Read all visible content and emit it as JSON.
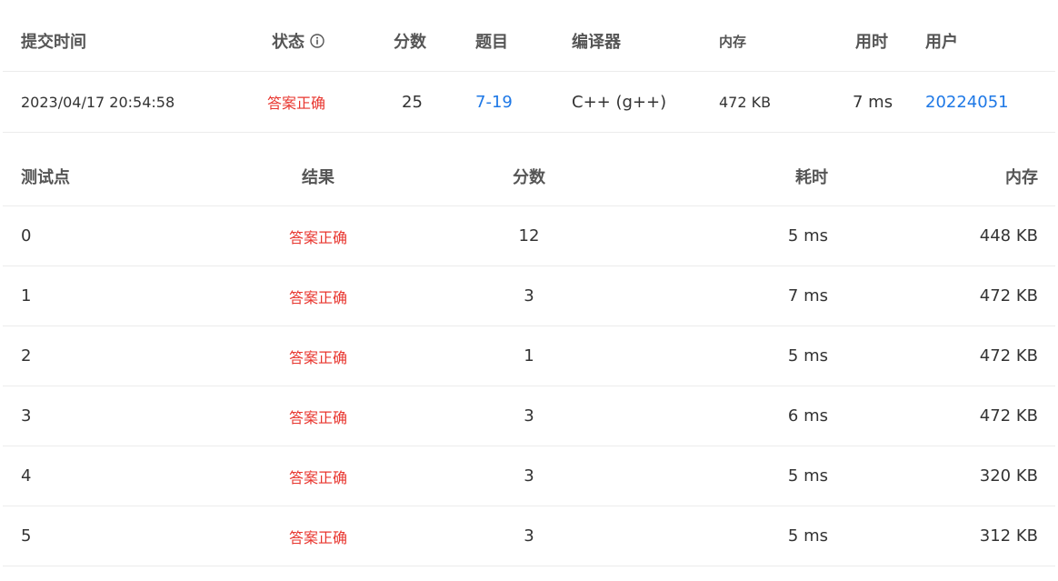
{
  "submission": {
    "headers": {
      "time": "提交时间",
      "status": "状态",
      "score": "分数",
      "problem": "题目",
      "compiler": "编译器",
      "memory": "内存",
      "elapsed": "用时",
      "user": "用户"
    },
    "row": {
      "time": "2023/04/17 20:54:58",
      "status": "答案正确",
      "score": "25",
      "problem": "7-19",
      "compiler": "C++ (g++)",
      "memory": "472 KB",
      "elapsed": "7 ms",
      "user": "20224051"
    }
  },
  "testcases": {
    "headers": {
      "id": "测试点",
      "result": "结果",
      "score": "分数",
      "time": "耗时",
      "memory": "内存"
    },
    "rows": [
      {
        "id": "0",
        "result": "答案正确",
        "score": "12",
        "time": "5 ms",
        "memory": "448 KB"
      },
      {
        "id": "1",
        "result": "答案正确",
        "score": "3",
        "time": "7 ms",
        "memory": "472 KB"
      },
      {
        "id": "2",
        "result": "答案正确",
        "score": "1",
        "time": "5 ms",
        "memory": "472 KB"
      },
      {
        "id": "3",
        "result": "答案正确",
        "score": "3",
        "time": "6 ms",
        "memory": "472 KB"
      },
      {
        "id": "4",
        "result": "答案正确",
        "score": "3",
        "time": "5 ms",
        "memory": "320 KB"
      },
      {
        "id": "5",
        "result": "答案正确",
        "score": "3",
        "time": "5 ms",
        "memory": "312 KB"
      }
    ]
  },
  "colors": {
    "accepted": "#e8352e",
    "link": "#1e78e6",
    "divider": "#ececec"
  },
  "icons": {
    "status_info": "info-circle-icon"
  }
}
